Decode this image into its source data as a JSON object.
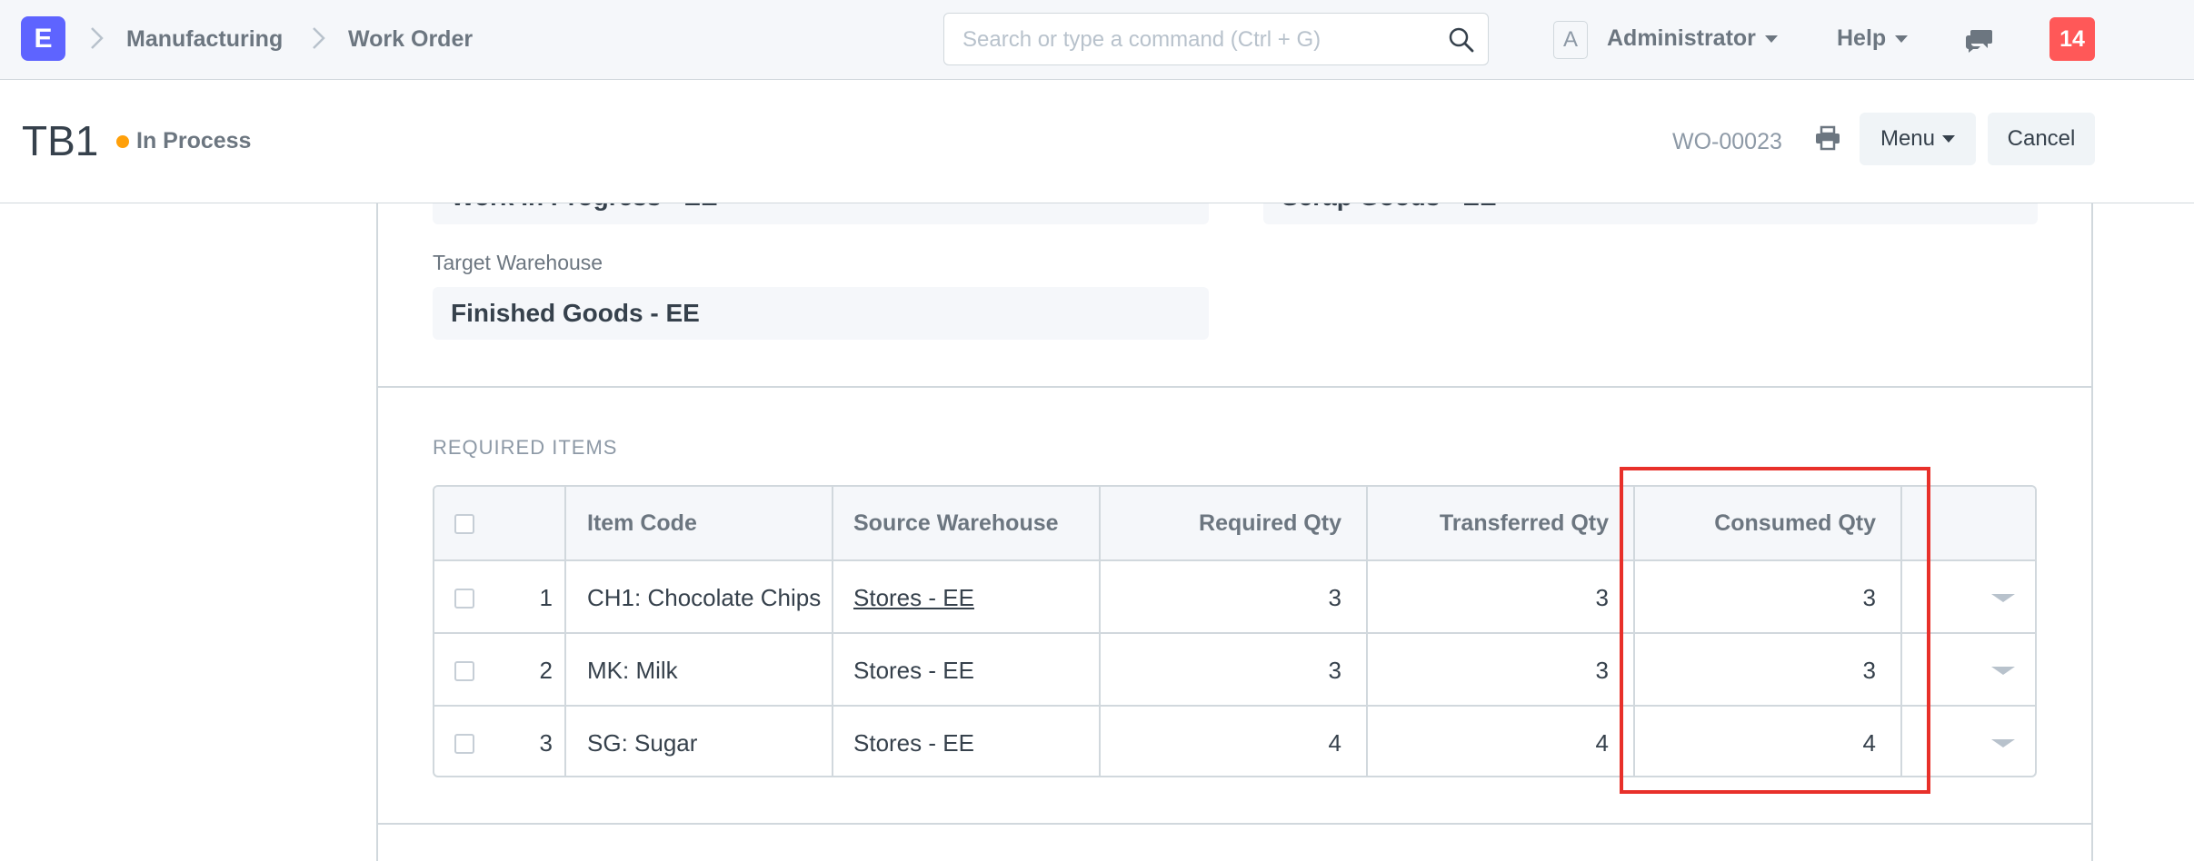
{
  "navbar": {
    "logo_letter": "E",
    "breadcrumbs": [
      "Manufacturing",
      "Work Order"
    ],
    "search_placeholder": "Search or type a command (Ctrl + G)",
    "avatar_letter": "A",
    "user_label": "Administrator",
    "help_label": "Help",
    "notification_count": "14"
  },
  "page_head": {
    "title": "TB1",
    "status": "In Process",
    "status_color": "#ffa00a",
    "doc_id": "WO-00023",
    "menu_label": "Menu",
    "cancel_label": "Cancel"
  },
  "form": {
    "wip_warehouse_value": "Work In Progress - EE",
    "scrap_warehouse_value": "Scrap Goods - EE",
    "target_warehouse_label": "Target Warehouse",
    "target_warehouse_value": "Finished Goods - EE",
    "section_label": "REQUIRED ITEMS"
  },
  "grid": {
    "headers": [
      "Item Code",
      "Source Warehouse",
      "Required Qty",
      "Transferred Qty",
      "Consumed Qty"
    ],
    "rows": [
      {
        "idx": "1",
        "item_code": "CH1: Chocolate Chips",
        "source_warehouse": "Stores - EE",
        "required_qty": "3",
        "transferred_qty": "3",
        "consumed_qty": "3"
      },
      {
        "idx": "2",
        "item_code": "MK: Milk",
        "source_warehouse": "Stores - EE",
        "required_qty": "3",
        "transferred_qty": "3",
        "consumed_qty": "3"
      },
      {
        "idx": "3",
        "item_code": "SG: Sugar",
        "source_warehouse": "Stores - EE",
        "required_qty": "4",
        "transferred_qty": "4",
        "consumed_qty": "4"
      }
    ]
  },
  "colors": {
    "brand": "#5e64ff",
    "notification": "#ff5858",
    "highlight": "#e8302a"
  }
}
